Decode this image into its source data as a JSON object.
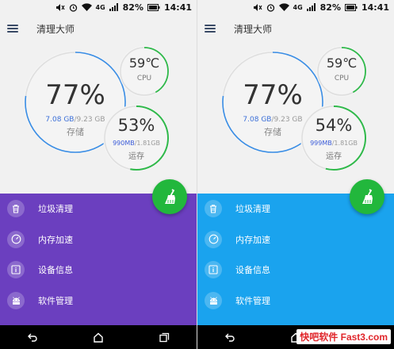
{
  "status_bar": {
    "battery": "82%",
    "time": "14:41",
    "network": "4G"
  },
  "app": {
    "title": "清理大师"
  },
  "storage": {
    "percent": "77%",
    "used": "7.08 GB",
    "total": "/9.23 GB",
    "label": "存储",
    "fraction": 0.77
  },
  "cpu": {
    "temp": "59℃",
    "label": "CPU",
    "fraction": 0.42
  },
  "menu_items": [
    {
      "label": "垃圾清理",
      "icon": "trash-icon"
    },
    {
      "label": "内存加速",
      "icon": "speedometer-icon"
    },
    {
      "label": "设备信息",
      "icon": "info-icon"
    },
    {
      "label": "软件管理",
      "icon": "android-icon"
    }
  ],
  "screens": [
    {
      "memory": {
        "percent": "53%",
        "used": "990MB",
        "total": "/1.81GB",
        "label": "运存",
        "fraction": 0.53
      },
      "panel_color": "#6b3fbf"
    },
    {
      "memory": {
        "percent": "54%",
        "used": "999MB",
        "total": "/1.81GB",
        "label": "运存",
        "fraction": 0.54
      },
      "panel_color": "#1aa3ee"
    }
  ],
  "colors": {
    "ring_blue": "#3a8ee6",
    "ring_green": "#2fb94a",
    "ring_track": "#dedede",
    "fab": "#22b73c"
  },
  "watermark": "快吧软件 Fast3.com"
}
